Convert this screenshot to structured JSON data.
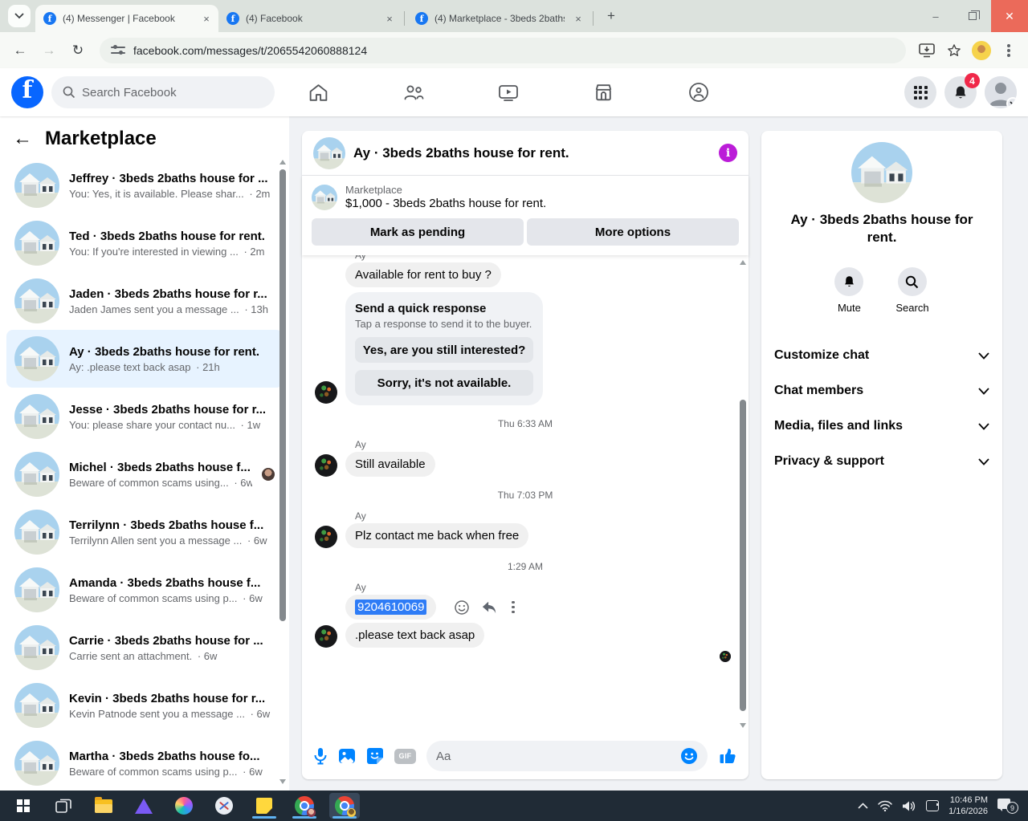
{
  "browser": {
    "tabs": [
      {
        "title": "(4) Messenger | Facebook"
      },
      {
        "title": "(4) Facebook"
      },
      {
        "title": "(4) Marketplace - 3beds 2baths"
      }
    ],
    "url": "facebook.com/messages/t/2065542060888124"
  },
  "fb_header": {
    "logo_letter": "f",
    "search_placeholder": "Search Facebook",
    "notification_count": "4"
  },
  "sidebar": {
    "back_arrow": "←",
    "title": "Marketplace",
    "conversations": [
      {
        "name": "Jeffrey · 3beds 2baths house for ...",
        "preview": "You: Yes, it is available. Please shar...",
        "time": "· 2m",
        "selected": false,
        "read_avatar": false
      },
      {
        "name": "Ted · 3beds 2baths house for rent.",
        "preview": "You: If you're interested in viewing ...",
        "time": "· 2m",
        "selected": false,
        "read_avatar": false
      },
      {
        "name": "Jaden · 3beds 2baths house for r...",
        "preview": "Jaden James sent you a message ...",
        "time": "· 13h",
        "selected": false,
        "read_avatar": false
      },
      {
        "name": "Ay · 3beds 2baths house for rent.",
        "preview": "Ay: .please text back asap",
        "time": "· 21h",
        "selected": true,
        "read_avatar": false
      },
      {
        "name": "Jesse · 3beds 2baths house for r...",
        "preview": "You: please share your contact nu...",
        "time": "· 1w",
        "selected": false,
        "read_avatar": false
      },
      {
        "name": "Michel · 3beds 2baths house f...",
        "preview": "Beware of common scams using...",
        "time": "· 6w",
        "selected": false,
        "read_avatar": true
      },
      {
        "name": "Terrilynn · 3beds 2baths house f...",
        "preview": "Terrilynn Allen sent you a message ...",
        "time": "· 6w",
        "selected": false,
        "read_avatar": false
      },
      {
        "name": "Amanda · 3beds 2baths house f...",
        "preview": "Beware of common scams using p...",
        "time": "· 6w",
        "selected": false,
        "read_avatar": false
      },
      {
        "name": "Carrie · 3beds 2baths house for ...",
        "preview": "Carrie sent an attachment.",
        "time": "· 6w",
        "selected": false,
        "read_avatar": false
      },
      {
        "name": "Kevin · 3beds 2baths house for r...",
        "preview": "Kevin Patnode sent you a message ...",
        "time": "· 6w",
        "selected": false,
        "read_avatar": false
      },
      {
        "name": "Martha · 3beds 2baths house fo...",
        "preview": "Beware of common scams using p...",
        "time": "· 6w",
        "selected": false,
        "read_avatar": false
      }
    ]
  },
  "chat": {
    "title": "Ay · 3beds 2baths house for rent.",
    "info_letter": "i",
    "banner": {
      "label": "Marketplace",
      "price_line": "$1,000 - 3beds 2baths house for rent.",
      "btn_pending": "Mark as pending",
      "btn_more": "More options"
    },
    "sender": "Ay",
    "msg1": "Available for rent to buy ?",
    "quick": {
      "title": "Send a quick response",
      "subtitle": "Tap a response to send it to the buyer.",
      "option1": "Yes, are you still interested?",
      "option2": "Sorry, it's not available."
    },
    "ts1": "Thu 6:33 AM",
    "msg2": "Still available",
    "ts2": "Thu 7:03 PM",
    "msg3": "Plz contact me back when free",
    "ts3": "1:29 AM",
    "msg4": "9204610069",
    "msg5": ".please text back asap",
    "composer": {
      "placeholder": "Aa",
      "gif_label": "GIF"
    }
  },
  "panel": {
    "title": "Ay · 3beds 2baths house for rent.",
    "mute_label": "Mute",
    "search_label": "Search",
    "sections": [
      "Customize chat",
      "Chat members",
      "Media, files and links",
      "Privacy & support"
    ]
  },
  "taskbar": {
    "time": "10:46 PM",
    "date": "1/16/2026",
    "notification_count": "9"
  },
  "colors": {
    "fb_blue": "#0866ff",
    "info_purple": "#bb1cd8",
    "selection_blue": "#2e7cf6",
    "badge_red": "#f02849",
    "composer_blue": "#0084ff"
  }
}
